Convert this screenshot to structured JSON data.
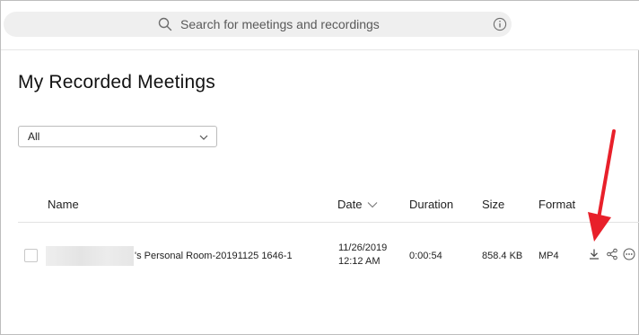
{
  "search": {
    "placeholder": "Search for meetings and recordings",
    "icon": "search-icon",
    "info_icon": "info-icon"
  },
  "page": {
    "title": "My Recorded Meetings"
  },
  "filter": {
    "selected": "All"
  },
  "table": {
    "columns": [
      "Name",
      "Date",
      "Duration",
      "Size",
      "Format"
    ],
    "rows": [
      {
        "name": "'s Personal Room-20191125 1646-1",
        "date_line1": "11/26/2019",
        "date_line2": "12:12 AM",
        "duration": "0:00:54",
        "size": "858.4 KB",
        "format": "MP4",
        "actions": [
          "download-icon",
          "share-icon",
          "more-icon"
        ]
      }
    ]
  },
  "colors": {
    "annotation_arrow": "#e8202a",
    "search_bg": "#efefef"
  }
}
